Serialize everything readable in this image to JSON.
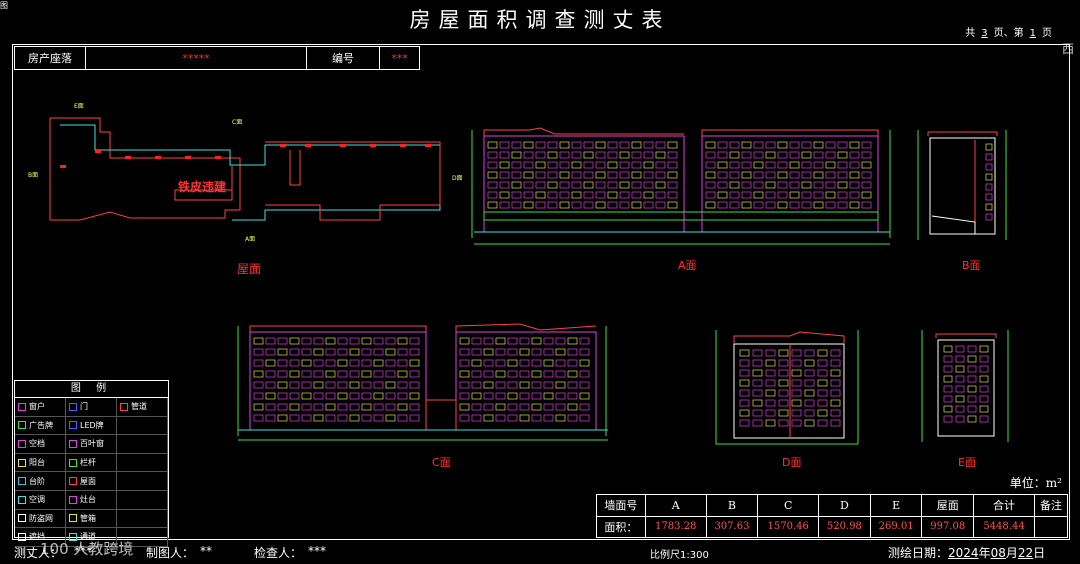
{
  "title": "房屋面积调查测丈表",
  "page_info": {
    "total_prefix": "共",
    "total": "3",
    "total_suffix": "页、第",
    "current": "1",
    "current_suffix": "页"
  },
  "corner_tl": "图",
  "corner_tr": "西",
  "info": {
    "address_label": "房产座落",
    "address_value": "*****",
    "number_label": "编号",
    "number_value": "***"
  },
  "drawing": {
    "roof_label": "屋面",
    "illegal_label": "铁皮违建",
    "marks": {
      "e": "E面",
      "c": "C面",
      "b": "B面",
      "d": "D面",
      "a": "A面"
    },
    "view_labels": {
      "a": "A面",
      "b": "B面",
      "c": "C面",
      "d": "D面",
      "e": "E面"
    }
  },
  "legend": {
    "title": "图 例",
    "rows": [
      [
        {
          "label": "窗户",
          "color": "#e040e0"
        },
        {
          "label": "门",
          "color": "#4060ff"
        },
        {
          "label": "管道",
          "color": "#ff4040"
        }
      ],
      [
        {
          "label": "广告牌",
          "color": "#40e040"
        },
        {
          "label": "LED牌",
          "color": "#4060ff"
        },
        {
          "label": "",
          "color": ""
        }
      ],
      [
        {
          "label": "空档",
          "color": "#e040e0"
        },
        {
          "label": "百叶窗",
          "color": "#e040e0"
        },
        {
          "label": "",
          "color": ""
        }
      ],
      [
        {
          "label": "阳台",
          "color": "#e0e040"
        },
        {
          "label": "栏杆",
          "color": "#40e040"
        },
        {
          "label": "",
          "color": ""
        }
      ],
      [
        {
          "label": "台阶",
          "color": "#40c0e0"
        },
        {
          "label": "屋面",
          "color": "#ff4040"
        },
        {
          "label": "",
          "color": ""
        }
      ],
      [
        {
          "label": "空调",
          "color": "#40e0e0"
        },
        {
          "label": "灶台",
          "color": "#e040e0"
        },
        {
          "label": "",
          "color": ""
        }
      ],
      [
        {
          "label": "防盗网",
          "color": "#ffffff"
        },
        {
          "label": "管箱",
          "color": "#e0e040"
        },
        {
          "label": "",
          "color": ""
        }
      ],
      [
        {
          "label": "遮挡",
          "color": "#ffffff"
        },
        {
          "label": "通道",
          "color": "#40e0e0"
        },
        {
          "label": "",
          "color": ""
        }
      ]
    ]
  },
  "unit": "单位：m²",
  "area_table": {
    "row_header": "墙面号",
    "area_label": "面积：",
    "columns": [
      "A",
      "B",
      "C",
      "D",
      "E",
      "屋面",
      "合计",
      "备注"
    ],
    "values": [
      "1783.28",
      "307.63",
      "1570.46",
      "520.98",
      "269.01",
      "997.08",
      "5448.44",
      ""
    ]
  },
  "footer": {
    "surveyor_label": "测丈人：",
    "surveyor_value": "***",
    "drafter_label": "制图人：",
    "drafter_value": "**",
    "checker_label": "检查人：",
    "checker_value": "***",
    "scale": "比例尺1:300",
    "date_label": "测绘日期：",
    "year": "2024",
    "year_suffix": "年",
    "month": "08",
    "month_suffix": "月",
    "day": "22",
    "day_suffix": "日"
  },
  "watermark": "100 人教跨境"
}
